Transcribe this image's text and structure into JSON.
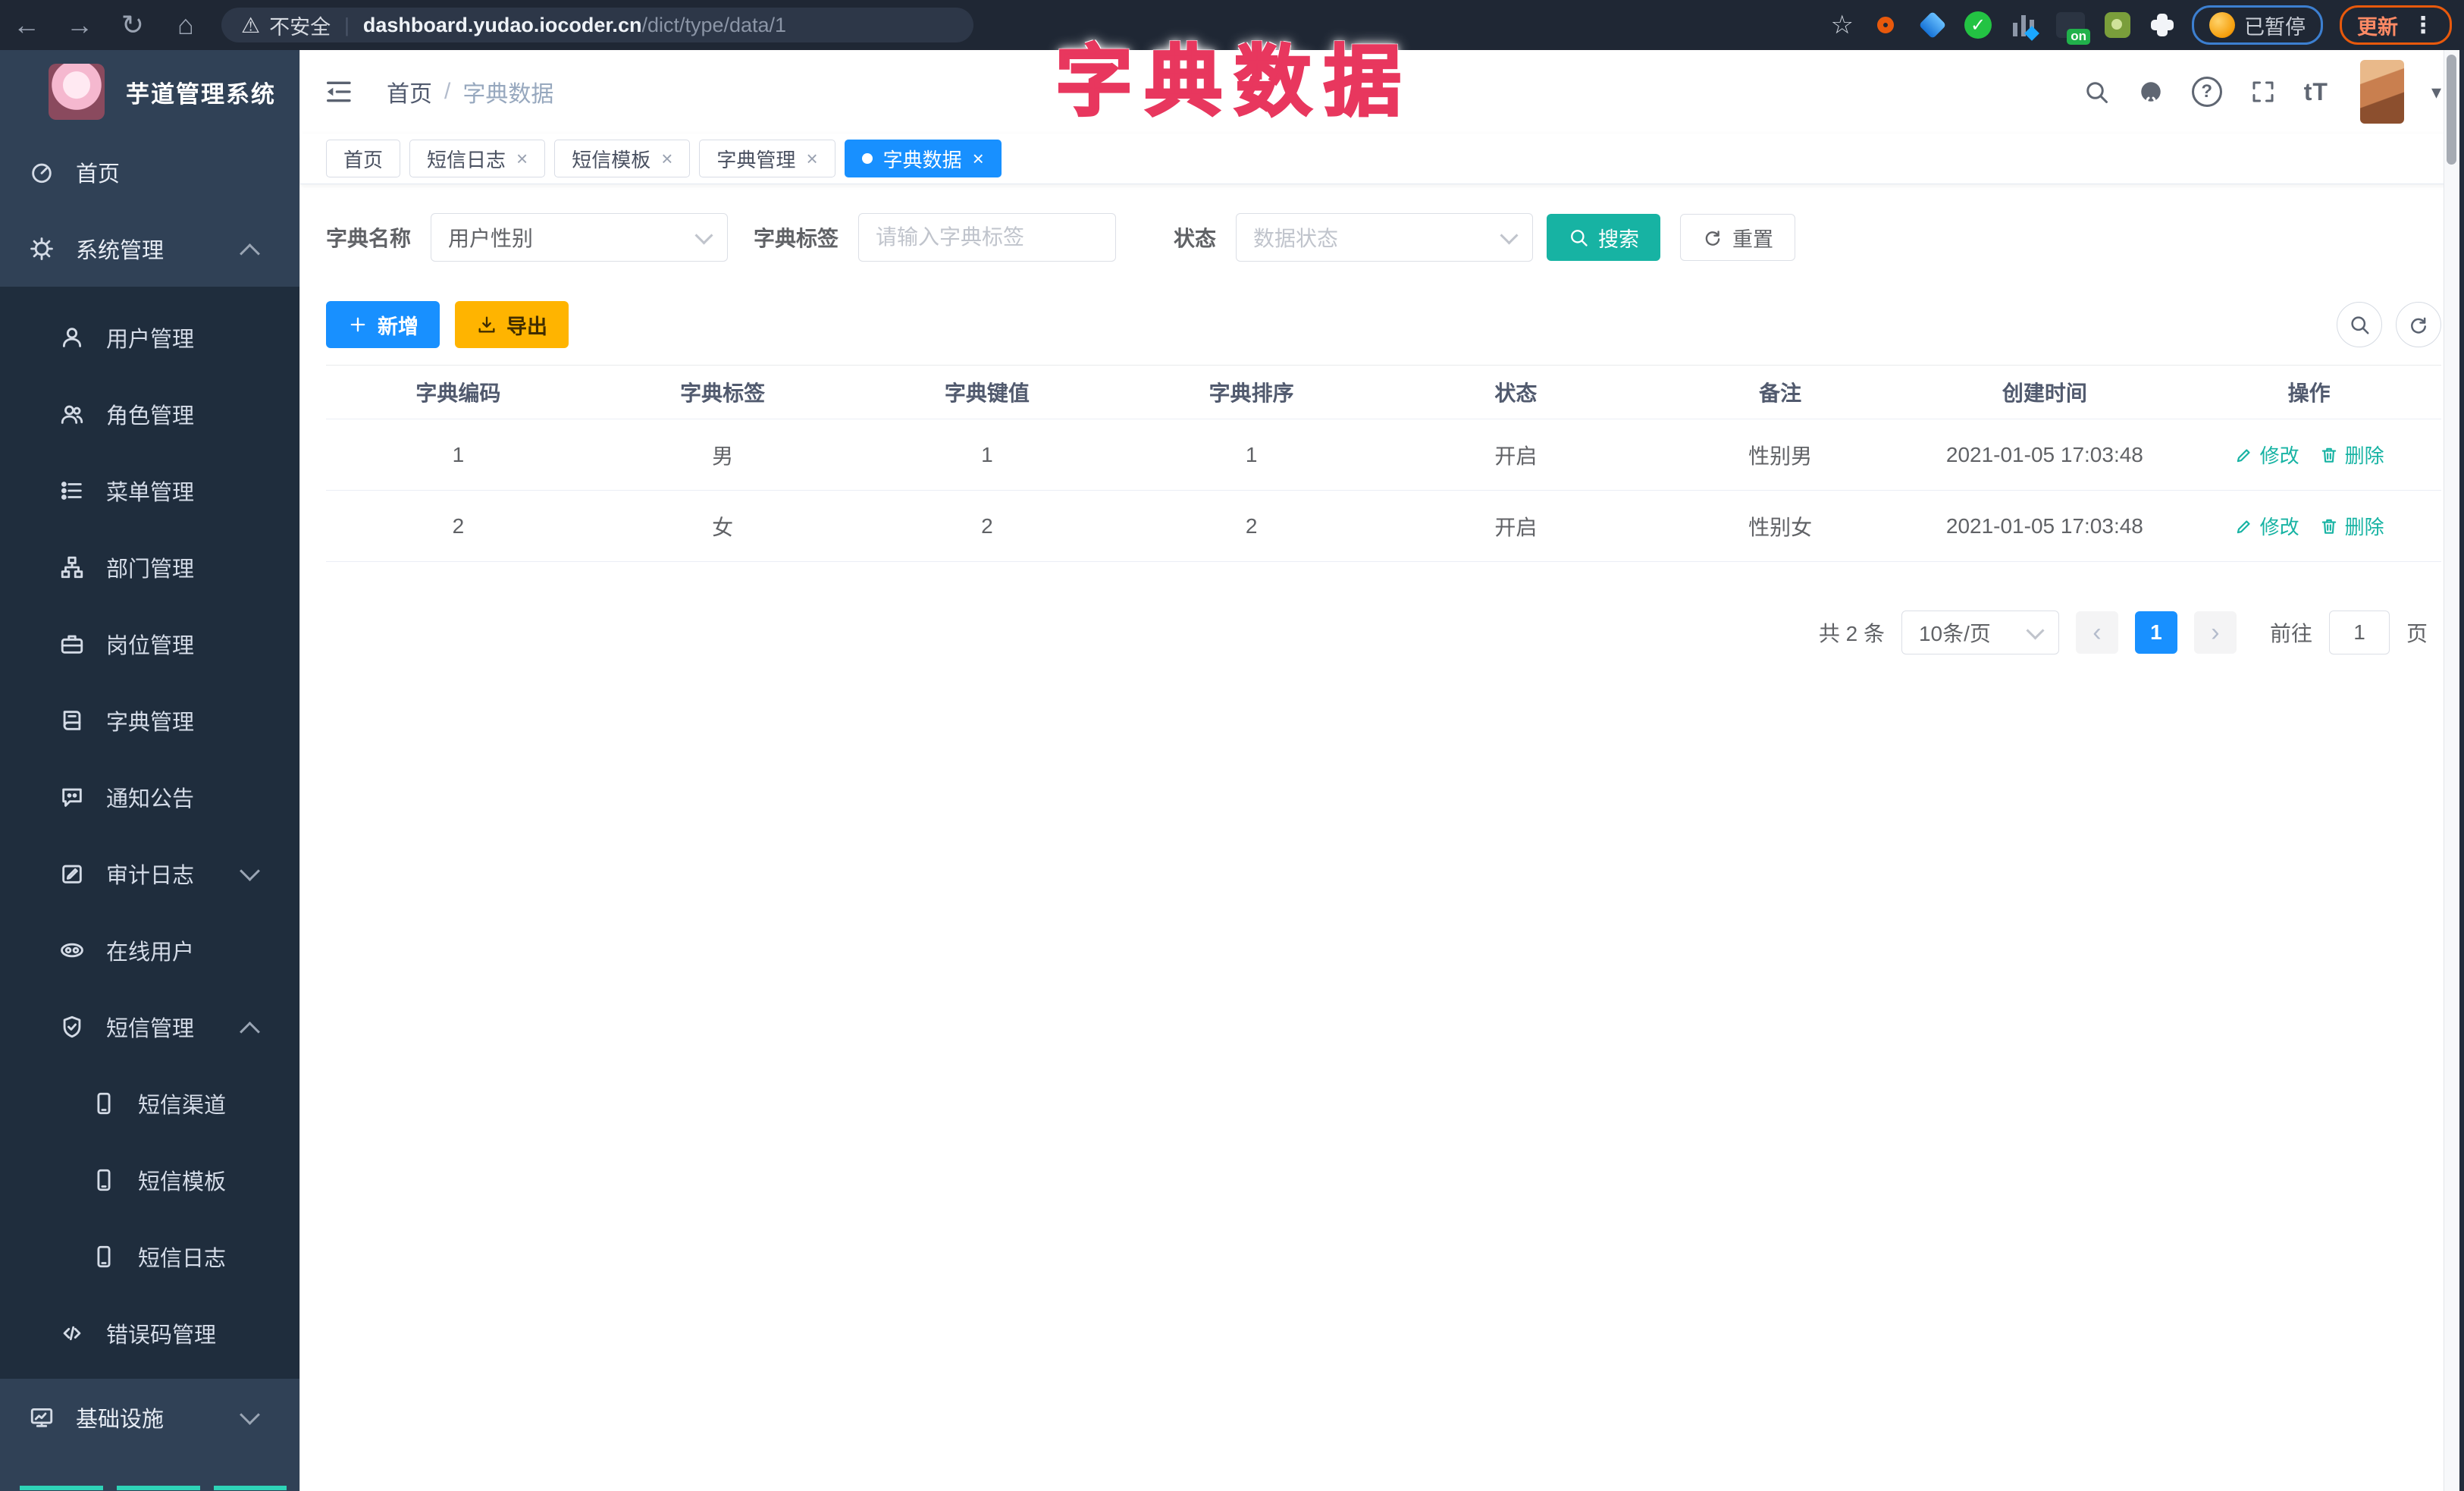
{
  "browser": {
    "security_label": "不安全",
    "url_host": "dashboard.yudao.iocoder.cn",
    "url_path": "/dict/type/data/1",
    "paused_label": "已暂停",
    "update_label": "更新",
    "on_badge": "on"
  },
  "icons": {
    "back": "←",
    "forward": "→",
    "reload": "↻",
    "home": "⌂",
    "warning": "⚠",
    "star": "☆",
    "kebab": "⋮",
    "pipe": "|",
    "caret_down": "▾",
    "slash": "/",
    "close": "×",
    "check": "✓",
    "question": "?",
    "text_size": "tT",
    "prev": "‹",
    "next": "›"
  },
  "overlay": {
    "title": "字典数据"
  },
  "sidebar": {
    "title": "芋道管理系统",
    "items": [
      {
        "label": "首页",
        "level": 1
      },
      {
        "label": "系统管理",
        "level": 1,
        "chevron": "up"
      },
      {
        "label": "用户管理",
        "level": 2
      },
      {
        "label": "角色管理",
        "level": 2
      },
      {
        "label": "菜单管理",
        "level": 2
      },
      {
        "label": "部门管理",
        "level": 2
      },
      {
        "label": "岗位管理",
        "level": 2
      },
      {
        "label": "字典管理",
        "level": 2
      },
      {
        "label": "通知公告",
        "level": 2
      },
      {
        "label": "审计日志",
        "level": 2,
        "chevron": "down"
      },
      {
        "label": "在线用户",
        "level": 2
      },
      {
        "label": "短信管理",
        "level": 2,
        "chevron": "up"
      },
      {
        "label": "短信渠道",
        "level": 3
      },
      {
        "label": "短信模板",
        "level": 3
      },
      {
        "label": "短信日志",
        "level": 3
      },
      {
        "label": "错误码管理",
        "level": 2
      },
      {
        "label": "基础设施",
        "level": 1,
        "chevron": "down"
      }
    ]
  },
  "header": {
    "breadcrumb_home": "首页",
    "breadcrumb_current": "字典数据"
  },
  "tabs": [
    {
      "label": "首页",
      "closable": false,
      "active": false
    },
    {
      "label": "短信日志",
      "closable": true,
      "active": false
    },
    {
      "label": "短信模板",
      "closable": true,
      "active": false
    },
    {
      "label": "字典管理",
      "closable": true,
      "active": false
    },
    {
      "label": "字典数据",
      "closable": true,
      "active": true
    }
  ],
  "filters": {
    "name_label": "字典名称",
    "name_value": "用户性别",
    "tag_label": "字典标签",
    "tag_placeholder": "请输入字典标签",
    "status_label": "状态",
    "status_placeholder": "数据状态",
    "search_label": "搜索",
    "reset_label": "重置"
  },
  "toolbar": {
    "add_label": "新增",
    "export_label": "导出"
  },
  "table": {
    "columns": [
      "字典编码",
      "字典标签",
      "字典键值",
      "字典排序",
      "状态",
      "备注",
      "创建时间",
      "操作"
    ],
    "rows": [
      {
        "code": "1",
        "label": "男",
        "value": "1",
        "sort": "1",
        "status": "开启",
        "remark": "性别男",
        "created": "2021-01-05 17:03:48",
        "edit": "修改",
        "del": "删除"
      },
      {
        "code": "2",
        "label": "女",
        "value": "2",
        "sort": "2",
        "status": "开启",
        "remark": "性别女",
        "created": "2021-01-05 17:03:48",
        "edit": "修改",
        "del": "删除"
      }
    ]
  },
  "pagination": {
    "total": "共 2 条",
    "page_size": "10条/页",
    "current": "1",
    "goto_label": "前往",
    "goto_value": "1",
    "page_unit": "页"
  },
  "colors": {
    "accent_blue": "#1890ff",
    "teal": "#17b3a3",
    "warning_yellow": "#ffb400",
    "overlay_pink": "#e8375e",
    "sidebar_bg": "#304156",
    "submenu_bg": "#1f2d3d"
  }
}
